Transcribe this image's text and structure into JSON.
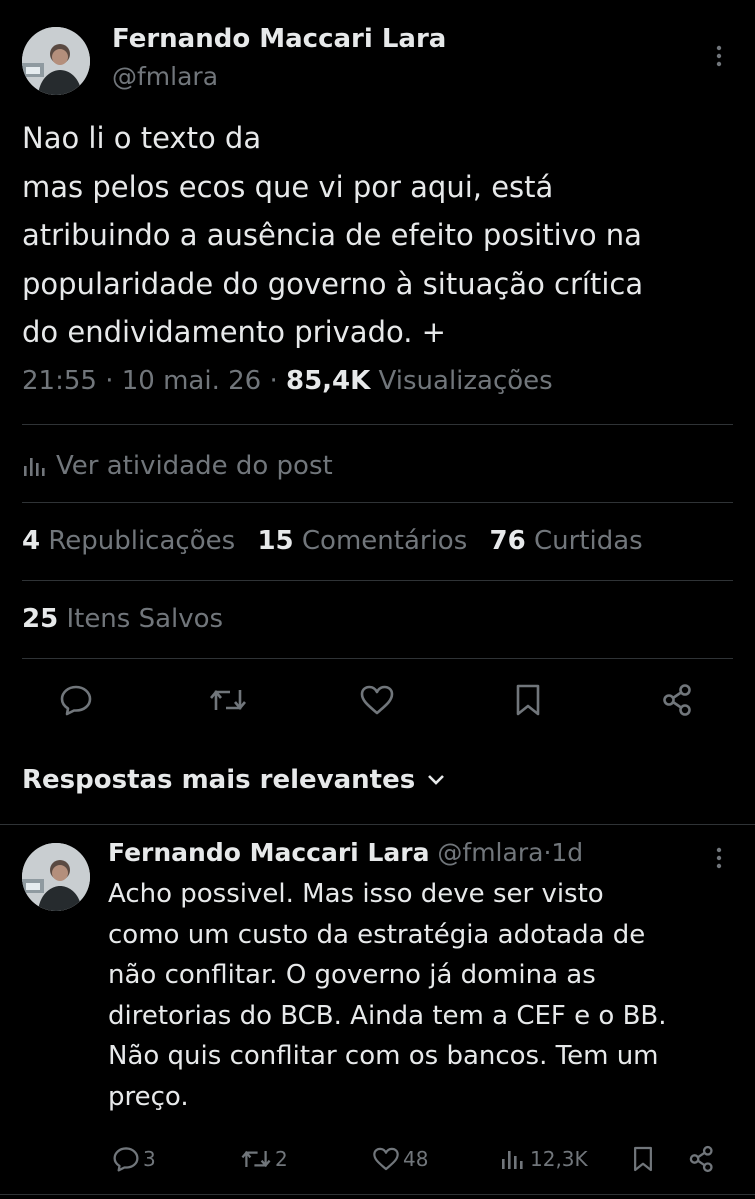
{
  "post": {
    "author_name": "Fernando Maccari Lara",
    "author_handle": "@fmlara",
    "text_line1": "Nao li o texto da",
    "text_line2": "mas pelos ecos que vi por aqui, está",
    "text_line3": "atribuindo a ausência de efeito positivo na",
    "text_line4": "popularidade do governo à situação crítica",
    "text_line5": "do endividamento privado. +",
    "time": "21:55",
    "sep1": "·",
    "date": "10 mai. 26",
    "sep2": "·",
    "views_count": "85,4K",
    "views_label": "Visualizações",
    "activity_label": "Ver atividade do post",
    "reposts_count": "4",
    "reposts_label": "Republicações",
    "comments_count": "15",
    "comments_label": "Comentários",
    "likes_count": "76",
    "likes_label": "Curtidas",
    "saves_count": "25",
    "saves_label": "Itens Salvos"
  },
  "replies_header": {
    "label": "Respostas mais relevantes"
  },
  "reply": {
    "author_name": "Fernando Maccari Lara",
    "author_handle": "@fmlara",
    "sep": "·",
    "age": "1d",
    "text_line1": "Acho possivel. Mas isso deve ser visto",
    "text_line2": "como um custo da estratégia adotada de",
    "text_line3": "não conflitar. O governo já domina as",
    "text_line4": "diretorias do BCB. Ainda tem a CEF e o BB.",
    "text_line5": "Não quis conflitar com os bancos. Tem um",
    "text_line6": "preço.",
    "replies_count": "3",
    "reposts_count": "2",
    "likes_count": "48",
    "views_count": "12,3K"
  },
  "icons": {
    "more": "more-vertical-icon",
    "chart": "analytics-icon",
    "reply": "reply-icon",
    "repost": "repost-icon",
    "like": "heart-icon",
    "bookmark": "bookmark-icon",
    "share": "share-icon",
    "chevron": "chevron-down-icon"
  },
  "colors": {
    "background": "#000000",
    "text": "#e7e9ea",
    "muted": "#71767b",
    "divider": "#2f3336"
  }
}
